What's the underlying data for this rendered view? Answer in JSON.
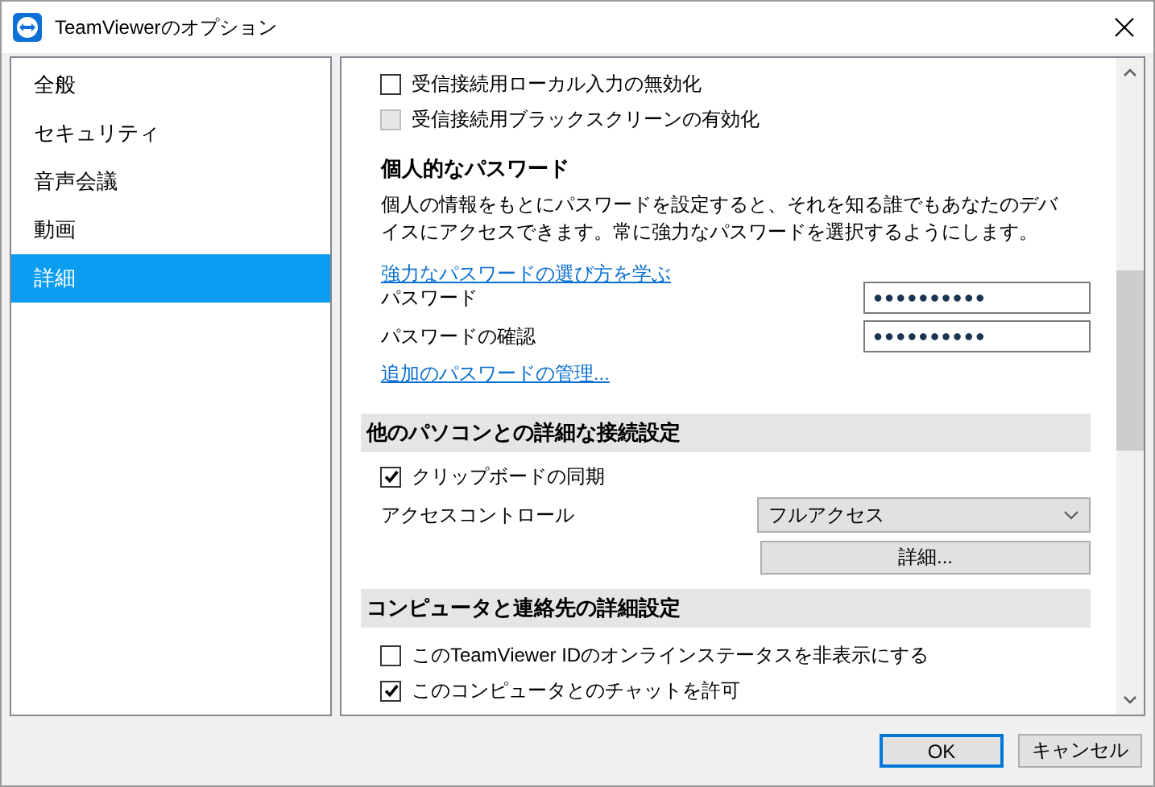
{
  "window": {
    "title": "TeamViewerのオプション"
  },
  "sidebar": {
    "items": [
      {
        "label": "全般",
        "selected": false
      },
      {
        "label": "セキュリティ",
        "selected": false
      },
      {
        "label": "音声会議",
        "selected": false
      },
      {
        "label": "動画",
        "selected": false
      },
      {
        "label": "詳細",
        "selected": true
      }
    ]
  },
  "content": {
    "items": [
      {
        "kind": "checkbox",
        "label": "受信接続用ローカル入力の無効化",
        "checked": false,
        "disabled": false
      },
      {
        "kind": "checkbox",
        "label": "受信接続用ブラックスクリーンの有効化",
        "checked": false,
        "disabled": true
      },
      {
        "kind": "heading",
        "label": "個人的なパスワード"
      },
      {
        "kind": "paragraph",
        "label": "個人の情報をもとにパスワードを設定すると、それを知る誰でもあなたのデバイスにアクセスできます。常に強力なパスワードを選択するようにします。"
      },
      {
        "kind": "link",
        "label": "強力なパスワードの選び方を学ぶ"
      },
      {
        "kind": "password",
        "label": "パスワード",
        "value": "●●●●●●●●●●"
      },
      {
        "kind": "password",
        "label": "パスワードの確認",
        "value": "●●●●●●●●●●"
      },
      {
        "kind": "link",
        "label": "追加のパスワードの管理..."
      },
      {
        "kind": "section",
        "label": "他のパソコンとの詳細な接続設定"
      },
      {
        "kind": "checkbox",
        "label": "クリップボードの同期",
        "checked": true,
        "disabled": false
      },
      {
        "kind": "dropdown",
        "label": "アクセスコントロール",
        "value": "フルアクセス"
      },
      {
        "kind": "button",
        "label": "詳細..."
      },
      {
        "kind": "section",
        "label": "コンピュータと連絡先の詳細設定"
      },
      {
        "kind": "checkbox",
        "label": "このTeamViewer IDのオンラインステータスを非表示にする",
        "checked": false,
        "disabled": false
      },
      {
        "kind": "checkbox",
        "label": "このコンピュータとのチャットを許可",
        "checked": true,
        "disabled": false
      }
    ]
  },
  "buttons": [
    {
      "label": "OK",
      "default": true
    },
    {
      "label": "キャンセル",
      "default": false
    }
  ]
}
